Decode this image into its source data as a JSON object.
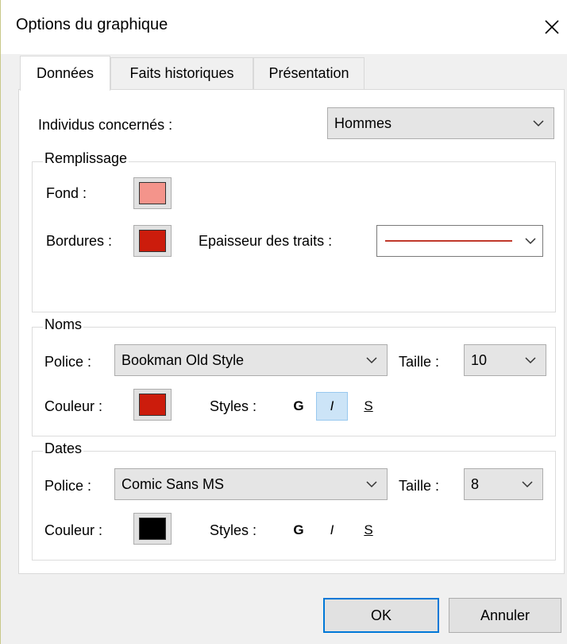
{
  "window": {
    "title": "Options du graphique"
  },
  "tabs": [
    {
      "label": "Données",
      "active": true
    },
    {
      "label": "Faits historiques",
      "active": false
    },
    {
      "label": "Présentation",
      "active": false
    }
  ],
  "individus": {
    "label": "Individus concernés :",
    "value": "Hommes"
  },
  "remplissage": {
    "legend": "Remplissage",
    "fond_label": "Fond :",
    "fond_color": "#f4948b",
    "bordures_label": "Bordures :",
    "bordures_color": "#cc1c0c",
    "epaisseur_label": "Epaisseur des traits :",
    "epaisseur_line_color": "#c0392b"
  },
  "noms": {
    "legend": "Noms",
    "police_label": "Police :",
    "police_value": "Bookman Old Style",
    "taille_label": "Taille :",
    "taille_value": "10",
    "couleur_label": "Couleur :",
    "couleur_color": "#cc1c0c",
    "styles_label": "Styles :",
    "bold": "G",
    "italic": "I",
    "underline": "S"
  },
  "dates": {
    "legend": "Dates",
    "police_label": "Police :",
    "police_value": "Comic Sans MS",
    "taille_label": "Taille :",
    "taille_value": "8",
    "couleur_label": "Couleur :",
    "couleur_color": "#000000",
    "styles_label": "Styles :",
    "bold": "G",
    "italic": "I",
    "underline": "S"
  },
  "buttons": {
    "ok": "OK",
    "cancel": "Annuler"
  },
  "accent": "#0078d7"
}
